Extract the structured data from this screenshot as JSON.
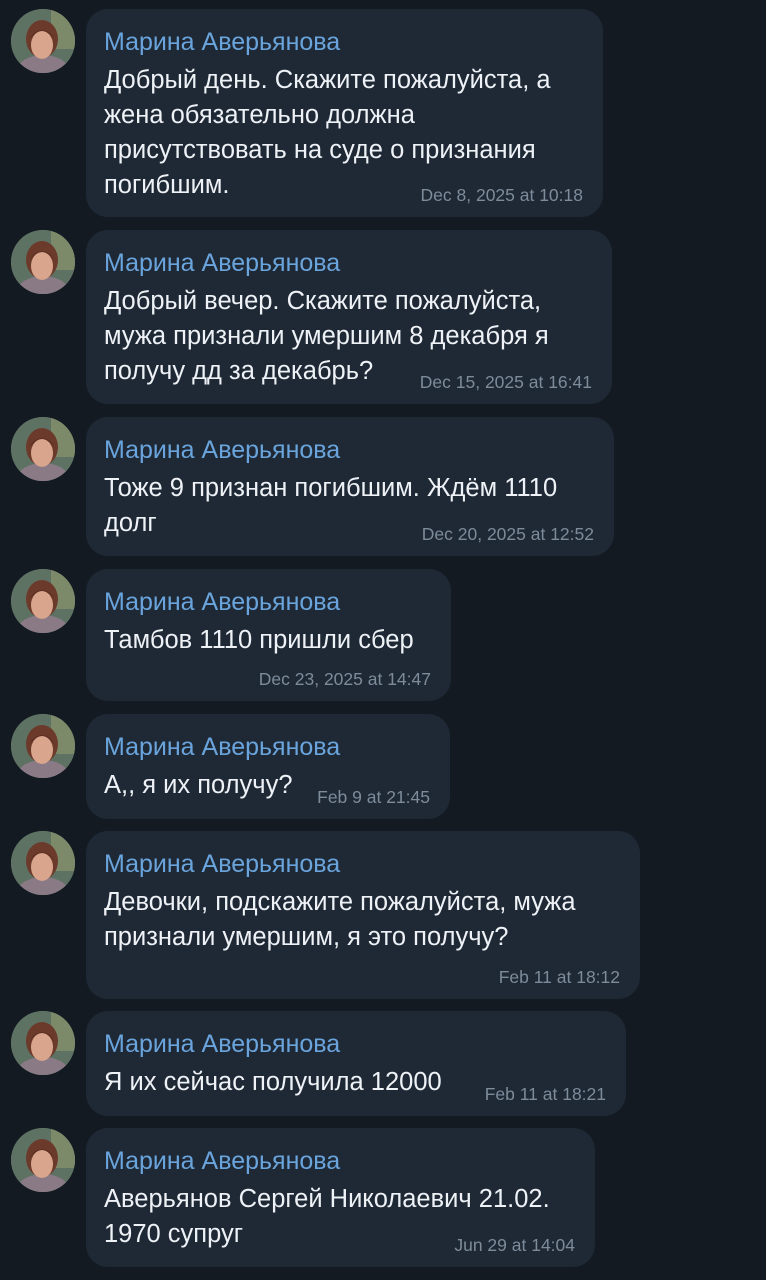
{
  "messages": [
    {
      "sender": "Марина Аверьянова",
      "lines": [
        "Добрый день. Скажите пожалуйста, а",
        "жена обязательно должна",
        "присутствовать на суде о признания",
        "погибшим."
      ],
      "time": "Dec 8, 2025 at 10:18"
    },
    {
      "sender": "Марина Аверьянова",
      "lines": [
        "Добрый вечер. Скажите пожалуйста,",
        "мужа признали умершим 8 декабря я",
        "получу дд за декабрь?"
      ],
      "time": "Dec 15, 2025 at 16:41"
    },
    {
      "sender": "Марина Аверьянова",
      "lines": [
        "Тоже 9 признан погибшим. Ждём 1110",
        "долг"
      ],
      "time": "Dec 20, 2025 at 12:52"
    },
    {
      "sender": "Марина Аверьянова",
      "lines": [
        "Тамбов 1110 пришли сбер"
      ],
      "time": "Dec 23, 2025 at 14:47"
    },
    {
      "sender": "Марина Аверьянова",
      "lines": [
        "А,, я их получу?"
      ],
      "time": "Feb 9 at 21:45"
    },
    {
      "sender": "Марина Аверьянова",
      "lines": [
        "Девочки, подскажите пожалуйста, мужа",
        "признали умершим, я это получу?"
      ],
      "time": "Feb 11 at 18:12"
    },
    {
      "sender": "Марина Аверьянова",
      "lines": [
        "Я их сейчас получила 12000"
      ],
      "time": "Feb 11 at 18:21"
    },
    {
      "sender": "Марина Аверьянова",
      "lines": [
        "Аверьянов Сергей Николаевич 21.02.",
        "1970 супруг"
      ],
      "time": "Jun 29 at 14:04"
    }
  ],
  "colors": {
    "background": "#131a22",
    "bubble": "#1f2936",
    "sender_name": "#6aa4dc",
    "message_text": "#eef2f6",
    "timestamp": "#7d8b9a"
  },
  "icons": {
    "avatar": "user-avatar-photo"
  }
}
